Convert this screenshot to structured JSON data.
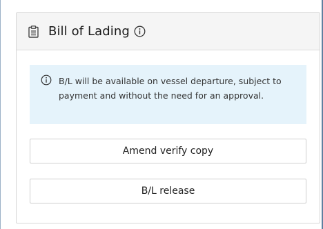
{
  "card": {
    "title": "Bill of Lading",
    "icon": "clipboard-icon",
    "title_info_icon": "info-circle-icon"
  },
  "notice": {
    "icon": "info-circle-icon",
    "text": "B/L will be available on vessel departure, subject to payment and without the need for an approval.",
    "background_color": "#e5f3fb"
  },
  "actions": {
    "amend_label": "Amend verify copy",
    "release_label": "B/L release"
  },
  "colors": {
    "header_background": "#f5f5f5",
    "border": "#d6d6d6",
    "text": "#1a1a1a"
  }
}
